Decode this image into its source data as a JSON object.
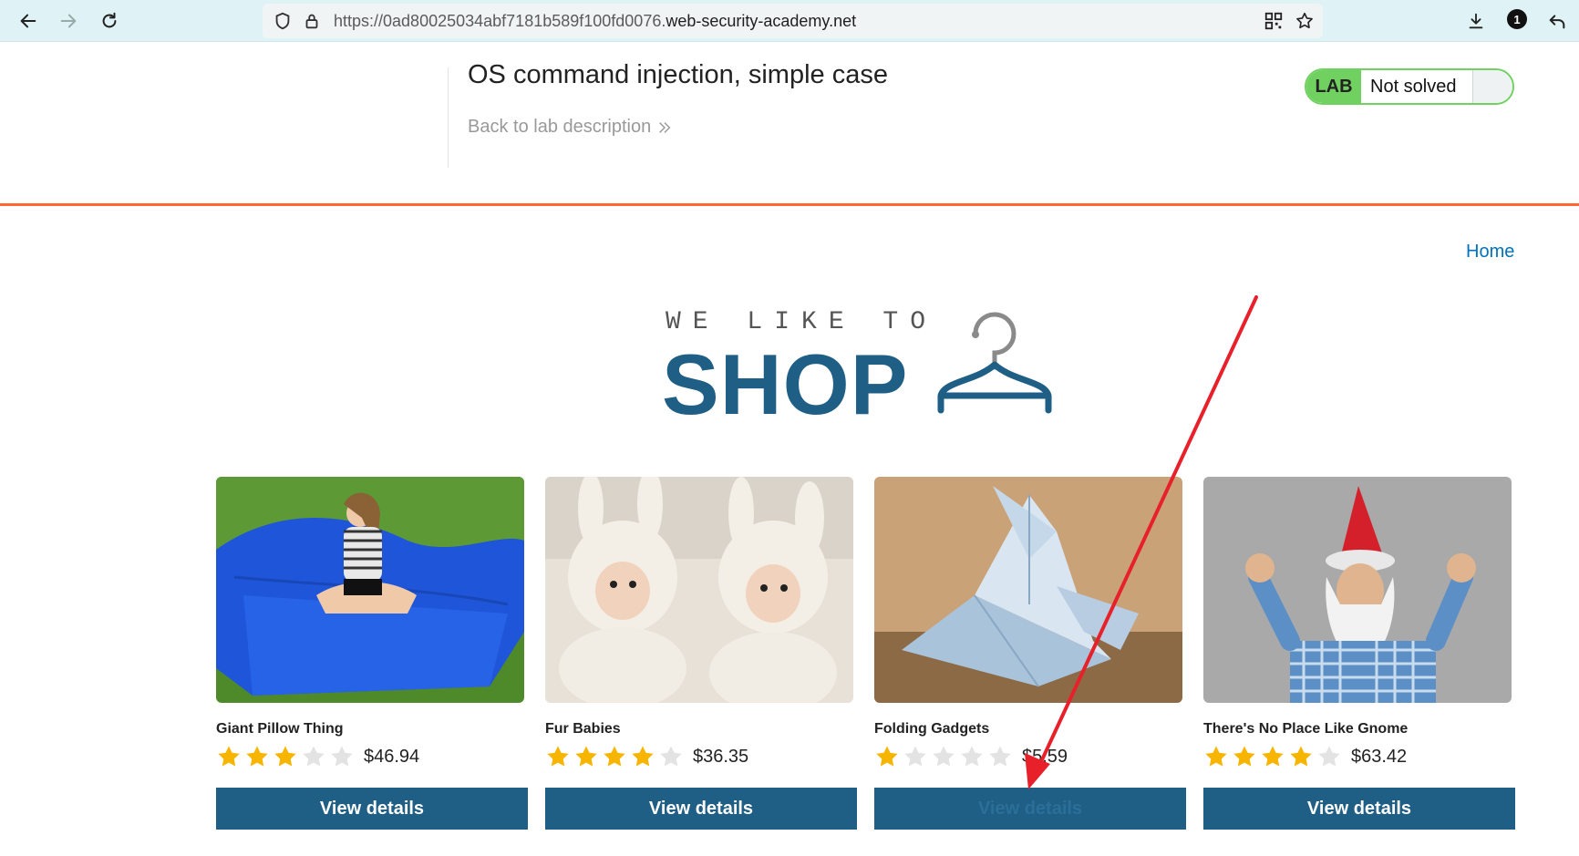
{
  "browser": {
    "url_prefix": "https://0ad80025034abf7181b589f100fd0076.",
    "url_domain": "web-security-academy.net",
    "notification_count": "1"
  },
  "lab": {
    "title": "OS command injection, simple case",
    "back_link": "Back to lab description",
    "tag": "LAB",
    "status": "Not solved"
  },
  "nav": {
    "home": "Home"
  },
  "logo": {
    "top_text": "WE LIKE TO",
    "main_text": "SHOP"
  },
  "products": [
    {
      "name": "Giant Pillow Thing",
      "rating": 3,
      "price": "$46.94",
      "button": "View details"
    },
    {
      "name": "Fur Babies",
      "rating": 4,
      "price": "$36.35",
      "button": "View details"
    },
    {
      "name": "Folding Gadgets",
      "rating": 1,
      "price": "$5.59",
      "button": "View details"
    },
    {
      "name": "There's No Place Like Gnome",
      "rating": 4,
      "price": "$63.42",
      "button": "View details"
    }
  ],
  "colors": {
    "accent": "#1f5f86",
    "header_rule": "#ff6633",
    "lab_green": "#70d161",
    "star_on": "#f7b500",
    "star_off": "#e3e3e3",
    "annotation_arrow": "#e8202a"
  }
}
